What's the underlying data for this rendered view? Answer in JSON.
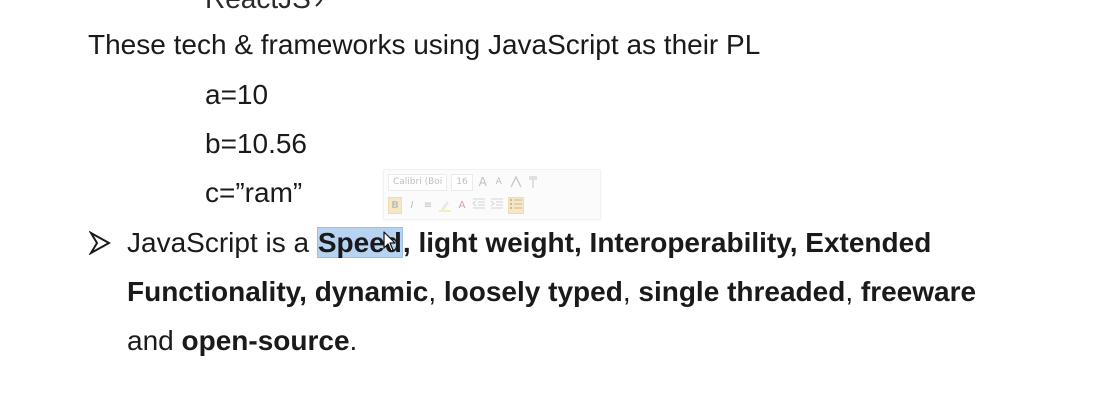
{
  "top_fragment": "ReactJS",
  "lines": {
    "intro": "These tech & frameworks using JavaScript as their PL",
    "var_a": "a=10",
    "var_b": "b=10.56",
    "var_c": "c=”ram”"
  },
  "bullet": {
    "icon": "arrow-bullet-icon",
    "prefix": "JavaScript is a ",
    "selected_word": "Speed",
    "part1_bold": ", light weight, Interoperability, Extended",
    "part2_bold_a": "Functionality, dynamic",
    "comma1": ", ",
    "part2_bold_b": "loosely typed",
    "comma2": ", ",
    "part2_bold_c": "single threaded",
    "comma3": ", ",
    "part2_bold_d": "freeware",
    "line3_and": "and ",
    "line3_bold": "open-source",
    "line3_end": "."
  },
  "mini_toolbar": {
    "font_name": "Calibri (Boi",
    "font_size": "16",
    "grow": "A",
    "shrink": "A",
    "bold": "B",
    "italic": "I",
    "align": "≡",
    "font_color": "A"
  },
  "colors": {
    "selection": "#b7d3f2",
    "text": "#1a1a1a"
  }
}
